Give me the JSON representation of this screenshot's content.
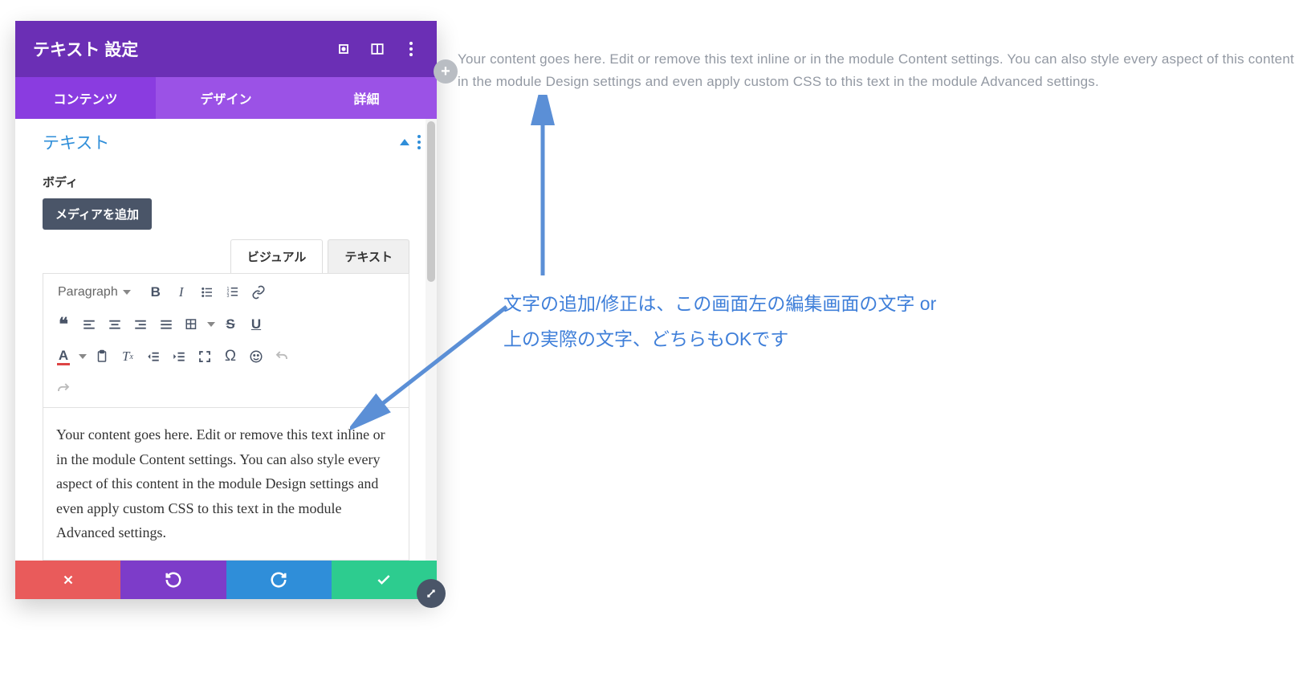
{
  "panel": {
    "title": "テキスト 設定",
    "tabs": {
      "content": "コンテンツ",
      "design": "デザイン",
      "advanced": "詳細",
      "active": "content"
    }
  },
  "section": {
    "title": "テキスト"
  },
  "body": {
    "label": "ボディ",
    "addMedia": "メディアを追加"
  },
  "editorTabs": {
    "visual": "ビジュアル",
    "text": "テキスト",
    "active": "visual"
  },
  "toolbar": {
    "formatLabel": "Paragraph",
    "icons": {
      "bold": "B",
      "italic": "I",
      "bulletList": "•",
      "numList": "1.",
      "link": "link",
      "quote": "❝",
      "alignLeft": "al",
      "alignCenter": "ac",
      "alignRight": "ar",
      "alignJustify": "aj",
      "table": "⊞",
      "strike": "S",
      "underline": "U",
      "textColor": "A",
      "paste": "📋",
      "clearFmt": "Tx",
      "outdent": "⇤",
      "indent": "⇥",
      "fullscreen": "⛶",
      "omega": "Ω",
      "emoji": "☺",
      "undo": "↶",
      "redo": "↷"
    }
  },
  "editor": {
    "content": "Your content goes here. Edit or remove this text inline or in the module Content settings. You can also style every aspect of this content in the module Design settings and even apply custom CSS to this text in the module Advanced settings."
  },
  "preview": {
    "content": "Your content goes here. Edit or remove this text inline or in the module Content settings. You can also style every aspect of this content in the module Design settings and even apply custom CSS to this text in the module Advanced settings."
  },
  "annotation": {
    "line1": "文字の追加/修正は、この画面左の編集画面の文字 or",
    "line2": "上の実際の文字、どちらもOKです"
  },
  "footer": {
    "close": "×",
    "undo": "↺",
    "redo": "↻",
    "save": "✓"
  },
  "colors": {
    "headerBg": "#6b2fb5",
    "tabsBg": "#9b52e6",
    "accentBlue": "#2f8ed9",
    "annotationBlue": "#3f7fd9"
  }
}
